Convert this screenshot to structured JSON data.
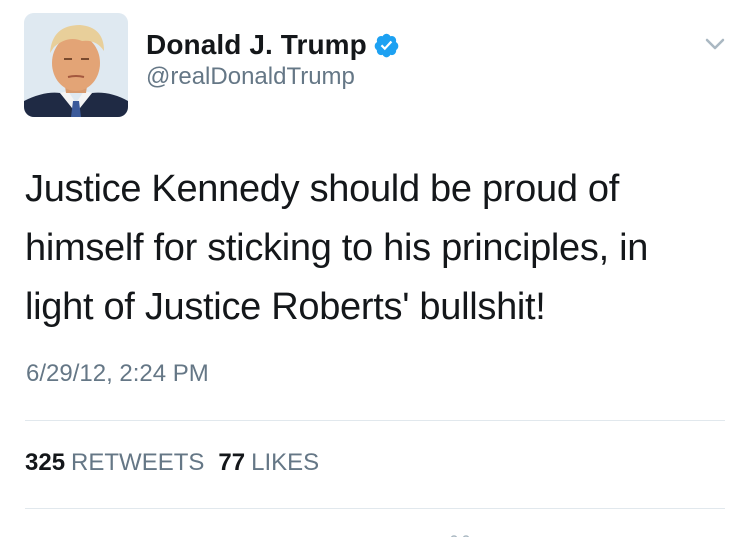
{
  "author": {
    "display_name": "Donald J. Trump",
    "handle": "@realDonaldTrump",
    "verified": true,
    "avatar_icon": "profile-photo"
  },
  "tweet": {
    "text": "Justice Kennedy should be proud of\nhimself for sticking to his principles, in\nlight of Justice Roberts' bullshit!",
    "timestamp": "6/29/12, 2:24 PM"
  },
  "stats": {
    "retweets_count": "325",
    "retweets_label": "RETWEETS",
    "likes_count": "77",
    "likes_label": "LIKES"
  },
  "icons": {
    "verified": "verified-badge-icon",
    "menu": "chevron-down-icon"
  },
  "colors": {
    "verified_blue": "#1da1f2",
    "text_primary": "#14171a",
    "text_secondary": "#657786",
    "divider": "#e1e8ed"
  }
}
